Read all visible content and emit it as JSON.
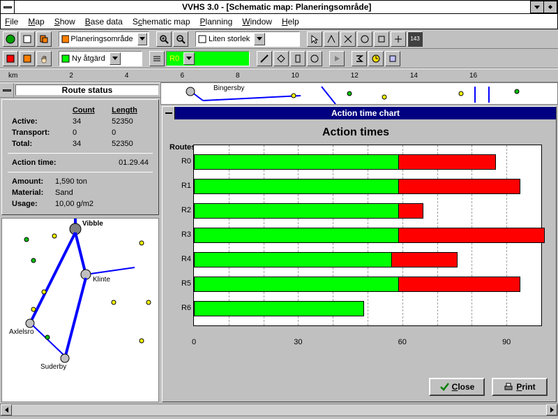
{
  "window": {
    "title": "VVHS 3.0 - [Schematic map: Planeringsområde]"
  },
  "menu": {
    "file": "File",
    "map": "Map",
    "show": "Show",
    "base_data": "Base data",
    "schematic_map": "Schematic map",
    "planning": "Planning",
    "window": "Window",
    "help": "Help"
  },
  "toolbar": {
    "combo1": "Planeringsområde",
    "combo2": "Liten storlek",
    "combo3": "Ny åtgärd",
    "combo4": "R0"
  },
  "ruler": {
    "unit": "km",
    "ticks": [
      "2",
      "4",
      "6",
      "8",
      "10",
      "12",
      "14",
      "16"
    ]
  },
  "route_status": {
    "title": "Route status",
    "headers": {
      "count": "Count",
      "length": "Length"
    },
    "rows": {
      "active": {
        "label": "Active:",
        "count": "34",
        "length": "52350"
      },
      "transport": {
        "label": "Transport:",
        "count": "0",
        "length": "0"
      },
      "total": {
        "label": "Total:",
        "count": "34",
        "length": "52350"
      }
    },
    "action_time_label": "Action time:",
    "action_time": "01.29.44",
    "amount_label": "Amount:",
    "amount": "1,590 ton",
    "material_label": "Material:",
    "material": "Sand",
    "usage_label": "Usage:",
    "usage": "10,00 g/m2"
  },
  "map": {
    "places_top": [
      "Bingersby"
    ],
    "places": [
      "Vibble",
      "Klinte",
      "Axlelsro",
      "Suderby"
    ]
  },
  "chart": {
    "window_title": "Action time chart",
    "title": "Action times",
    "ylabel": "Routes",
    "close": "Close",
    "print": "Print"
  },
  "chart_data": {
    "type": "bar",
    "categories": [
      "R0",
      "R1",
      "R2",
      "R3",
      "R4",
      "R5",
      "R6"
    ],
    "series": [
      {
        "name": "green",
        "color": "#00ff00",
        "values": [
          59,
          59,
          59,
          59,
          57,
          59,
          49
        ]
      },
      {
        "name": "red",
        "color": "#ff0000",
        "values": [
          28,
          35,
          7,
          42,
          19,
          35,
          0
        ]
      }
    ],
    "title": "Action times",
    "xlabel": "",
    "ylabel": "Routes",
    "xlim": [
      0,
      100
    ],
    "xticks": [
      0,
      30,
      60,
      90
    ]
  }
}
